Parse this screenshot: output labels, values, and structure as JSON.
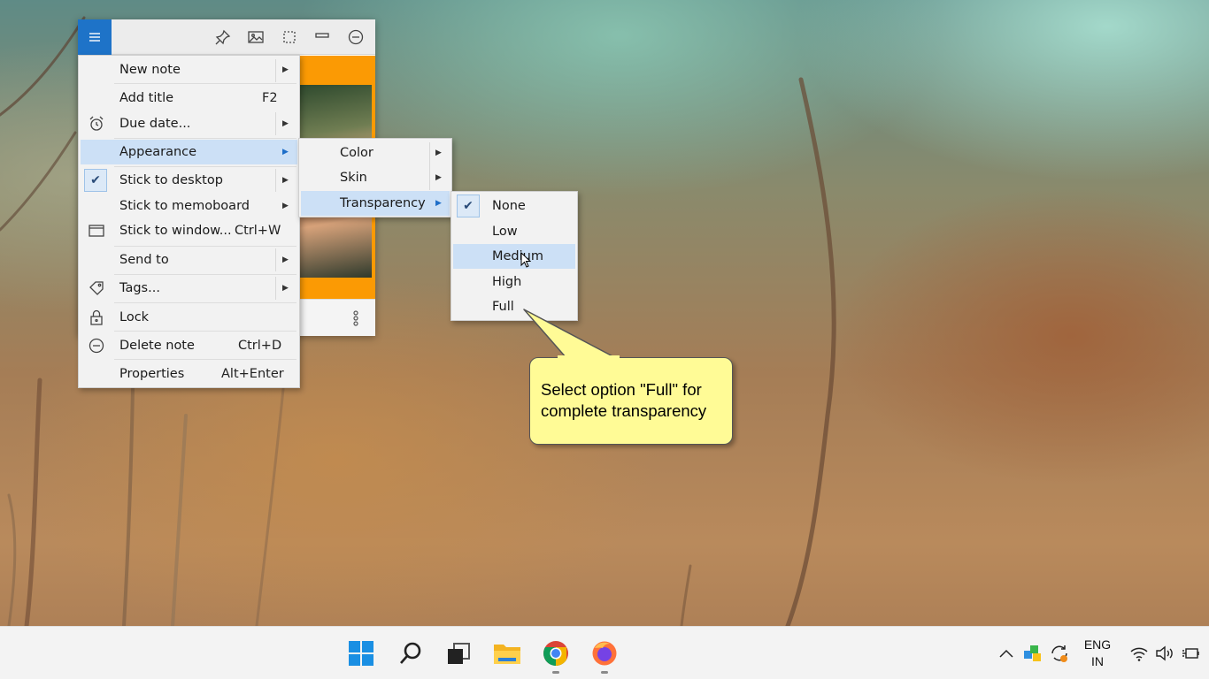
{
  "main_menu": {
    "items": [
      {
        "label": "New note",
        "shortcut": "",
        "submenu": true,
        "icon": ""
      },
      {
        "label": "Add title",
        "shortcut": "F2",
        "submenu": false,
        "icon": ""
      },
      {
        "label": "Due date...",
        "shortcut": "",
        "submenu": true,
        "icon": "alarm-clock-icon"
      },
      {
        "label": "Appearance",
        "shortcut": "",
        "submenu": true,
        "icon": "",
        "highlighted": true
      },
      {
        "label": "Stick to desktop",
        "shortcut": "",
        "submenu": true,
        "icon": "checkmark-icon",
        "checked": true
      },
      {
        "label": "Stick to memoboard",
        "shortcut": "",
        "submenu": true,
        "icon": ""
      },
      {
        "label": "Stick to window...",
        "shortcut": "Ctrl+W",
        "submenu": false,
        "icon": "window-icon"
      },
      {
        "label": "Send to",
        "shortcut": "",
        "submenu": true,
        "icon": ""
      },
      {
        "label": "Tags...",
        "shortcut": "",
        "submenu": true,
        "icon": "tag-icon"
      },
      {
        "label": "Lock",
        "shortcut": "",
        "submenu": false,
        "icon": "lock-icon"
      },
      {
        "label": "Delete note",
        "shortcut": "Ctrl+D",
        "submenu": false,
        "icon": "minus-circle-icon"
      },
      {
        "label": "Properties",
        "shortcut": "Alt+Enter",
        "submenu": false,
        "icon": ""
      }
    ]
  },
  "appearance_menu": {
    "items": [
      {
        "label": "Color",
        "submenu": true
      },
      {
        "label": "Skin",
        "submenu": true
      },
      {
        "label": "Transparency",
        "submenu": true,
        "highlighted": true
      }
    ]
  },
  "transparency_menu": {
    "items": [
      {
        "label": "None",
        "checked": true
      },
      {
        "label": "Low"
      },
      {
        "label": "Medium",
        "highlighted": true
      },
      {
        "label": "High"
      },
      {
        "label": "Full"
      }
    ]
  },
  "callout": {
    "text": "Select option \"Full\" for complete transparency"
  },
  "note_toolbar": {
    "icons": [
      "menu-icon",
      "pin-icon",
      "image-icon",
      "select-icon",
      "minimize-icon",
      "minus-circle-icon"
    ]
  },
  "taskbar": {
    "apps": [
      "windows-start-icon",
      "search-icon",
      "task-view-icon",
      "file-explorer-icon",
      "chrome-icon",
      "firefox-icon"
    ],
    "lang_line1": "ENG",
    "lang_line2": "IN"
  },
  "colors": {
    "accent": "#1e73c8",
    "note": "#fb9a04",
    "highlight": "#cce0f6",
    "callout": "#fffb96"
  }
}
